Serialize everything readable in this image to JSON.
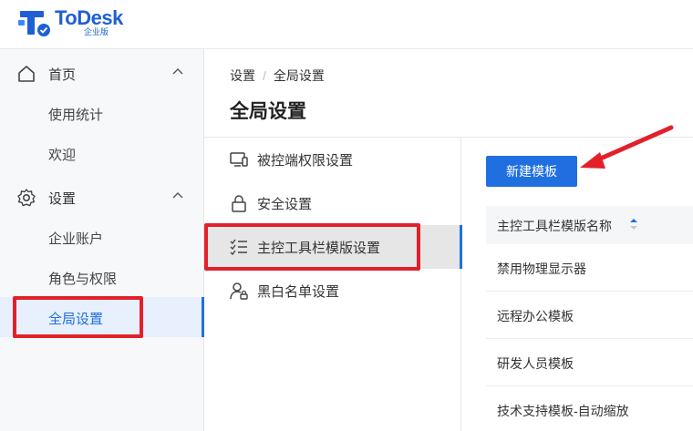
{
  "app": {
    "logo_text": "ToDesk",
    "logo_sub": "企业版",
    "brand_color": "#1f5fd6"
  },
  "sidebar": {
    "groups": [
      {
        "label": "首页",
        "icon": "home-icon",
        "expanded": true,
        "items": [
          {
            "label": "使用统计"
          },
          {
            "label": "欢迎"
          }
        ]
      },
      {
        "label": "设置",
        "icon": "gear-icon",
        "expanded": true,
        "items": [
          {
            "label": "企业账户"
          },
          {
            "label": "角色与权限"
          },
          {
            "label": "全局设置",
            "active": true
          }
        ]
      }
    ]
  },
  "breadcrumb": {
    "parent": "设置",
    "separator": "/",
    "current": "全局设置"
  },
  "page_title": "全局设置",
  "subnav": {
    "items": [
      {
        "label": "被控端权限设置",
        "icon": "monitor-icon"
      },
      {
        "label": "安全设置",
        "icon": "lock-icon"
      },
      {
        "label": "主控工具栏模版设置",
        "icon": "checklist-icon",
        "active": true
      },
      {
        "label": "黑白名单设置",
        "icon": "user-lock-icon"
      }
    ]
  },
  "content": {
    "new_button": "新建模板",
    "table": {
      "header": "主控工具栏模版名称",
      "rows": [
        "禁用物理显示器",
        "远程办公模板",
        "研发人员模板",
        "技术支持模板-自动缩放"
      ]
    }
  },
  "colors": {
    "accent": "#1f6fe0",
    "highlight": "#e3202a",
    "active_bg": "#e8f0fd"
  }
}
